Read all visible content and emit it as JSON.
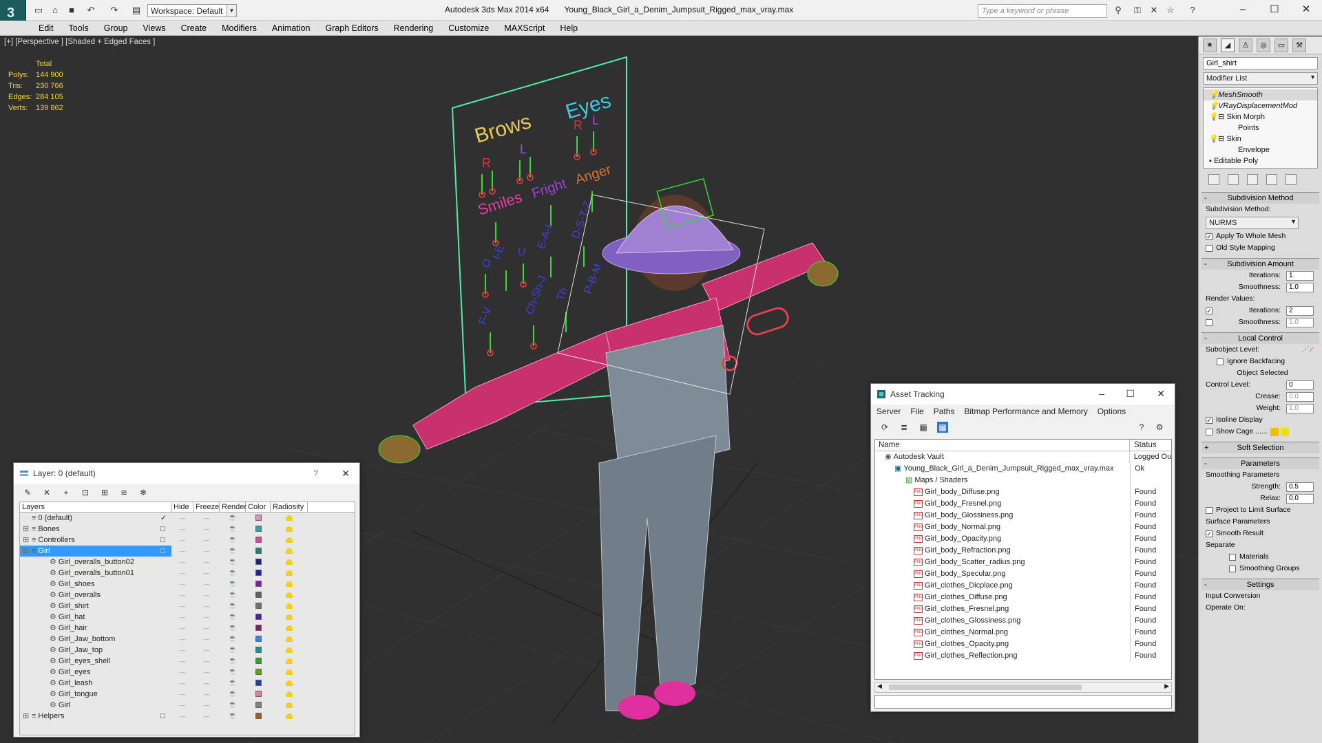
{
  "window": {
    "app_title": "Autodesk 3ds Max  2014 x64",
    "file_title": "Young_Black_Girl_a_Denim_Jumpsuit_Rigged_max_vray.max",
    "workspace": "Workspace: Default",
    "search_placeholder": "Type a keyword or phrase"
  },
  "menu": [
    "Edit",
    "Tools",
    "Group",
    "Views",
    "Create",
    "Modifiers",
    "Animation",
    "Graph Editors",
    "Rendering",
    "Customize",
    "MAXScript",
    "Help"
  ],
  "viewport": {
    "label": "[+] [Perspective ] [Shaded + Edged Faces ]",
    "stats": {
      "total_label": "Total",
      "rows": [
        {
          "k": "Polys:",
          "v": "144 900"
        },
        {
          "k": "Tris:",
          "v": "230 766"
        },
        {
          "k": "Edges:",
          "v": "284 105"
        },
        {
          "k": "Verts:",
          "v": "139 862"
        }
      ]
    },
    "board": {
      "brows": "Brows",
      "eyes": "Eyes",
      "r": "R",
      "l": "L",
      "smiles": "Smiles",
      "fright": "Fright",
      "anger": "Anger",
      "phon1": "O",
      "phon2": "I-E",
      "phon3": "U",
      "phon4": "E-A-I",
      "phon5": "D-S-T-Z",
      "phon6": "F-V",
      "phon7": "Ch-Sh-J",
      "phon8": "Th",
      "phon9": "P-B-M"
    },
    "colors": {
      "pink": "#e0307a",
      "cyan": "#40c8e8",
      "green": "#33dd33",
      "board": "#4ef0a0"
    }
  },
  "command_panel": {
    "object_name": "Girl_shirt",
    "modifier_list": "Modifier List",
    "stack": [
      {
        "label": "MeshSmooth",
        "style": "sel"
      },
      {
        "label": "VRayDisplacementMod",
        "style": "ital"
      },
      {
        "label": "Skin Morph",
        "style": "norm"
      },
      {
        "label": "Points",
        "style": "sub"
      },
      {
        "label": "Skin",
        "style": "norm"
      },
      {
        "label": "Envelope",
        "style": "sub"
      },
      {
        "label": "Editable Poly",
        "style": "norm"
      }
    ],
    "subdivision_method": {
      "title": "Subdivision Method",
      "label": "Subdivision Method:",
      "value": "NURMS",
      "apply_whole": "Apply To Whole Mesh",
      "old_style": "Old Style Mapping"
    },
    "subdivision_amount": {
      "title": "Subdivision Amount",
      "iterations_label": "Iterations:",
      "iterations": "1",
      "smoothness_label": "Smoothness:",
      "smoothness": "1.0",
      "render_values": "Render Values:",
      "r_iterations": "2",
      "r_smoothness": "1.0"
    },
    "local_control": {
      "title": "Local Control",
      "subobject_level": "Subobject Level:",
      "ignore_backfacing": "Ignore Backfacing",
      "object_selected": "Object Selected",
      "control_level_label": "Control Level:",
      "control_level": "0",
      "crease_label": "Crease:",
      "crease": "0.0",
      "weight_label": "Weight:",
      "weight": "1.0",
      "isoline": "Isoline Display",
      "show_cage": "Show Cage ......"
    },
    "soft_selection": "Soft Selection",
    "parameters": {
      "title": "Parameters",
      "smoothing": "Smoothing Parameters",
      "strength_label": "Strength:",
      "strength": "0.5",
      "relax_label": "Relax:",
      "relax": "0.0",
      "project": "Project to Limit Surface",
      "surface": "Surface Parameters",
      "smooth_result": "Smooth Result",
      "separate": "Separate",
      "materials": "Materials",
      "smoothing_groups": "Smoothing Groups"
    },
    "settings": {
      "title": "Settings",
      "input_conversion": "Input Conversion",
      "operate_on": "Operate On:"
    }
  },
  "layer_window": {
    "title": "Layer: 0 (default)",
    "help": "?",
    "columns": [
      "Layers",
      "Hide",
      "Freeze",
      "Render",
      "Color",
      "Radiosity"
    ],
    "rows": [
      {
        "name": "0 (default)",
        "indent": 0,
        "color": "#e090c0",
        "check": "✓",
        "tree": "",
        "sel": false
      },
      {
        "name": "Bones",
        "indent": 0,
        "color": "#30a0a0",
        "check": "□",
        "tree": "⊞",
        "sel": false
      },
      {
        "name": "Controllers",
        "indent": 0,
        "color": "#e040a0",
        "check": "□",
        "tree": "⊞",
        "sel": false
      },
      {
        "name": "Girl",
        "indent": 0,
        "color": "#208080",
        "check": "□",
        "tree": "⊟",
        "sel": true
      },
      {
        "name": "Girl_overalls_button02",
        "indent": 1,
        "color": "#202080",
        "check": "",
        "tree": "",
        "sel": false
      },
      {
        "name": "Girl_overalls_button01",
        "indent": 1,
        "color": "#2020a0",
        "check": "",
        "tree": "",
        "sel": false
      },
      {
        "name": "Girl_shoes",
        "indent": 1,
        "color": "#8020a0",
        "check": "",
        "tree": "",
        "sel": false
      },
      {
        "name": "Girl_overalls",
        "indent": 1,
        "color": "#606060",
        "check": "",
        "tree": "",
        "sel": false
      },
      {
        "name": "Girl_shirt",
        "indent": 1,
        "color": "#707070",
        "check": "",
        "tree": "",
        "sel": false
      },
      {
        "name": "Girl_hat",
        "indent": 1,
        "color": "#5020a0",
        "check": "",
        "tree": "",
        "sel": false
      },
      {
        "name": "Girl_hair",
        "indent": 1,
        "color": "#802060",
        "check": "",
        "tree": "",
        "sel": false
      },
      {
        "name": "Girl_Jaw_bottom",
        "indent": 1,
        "color": "#4080e0",
        "check": "",
        "tree": "",
        "sel": false
      },
      {
        "name": "Girl_Jaw_top",
        "indent": 1,
        "color": "#209090",
        "check": "",
        "tree": "",
        "sel": false
      },
      {
        "name": "Girl_eyes_shell",
        "indent": 1,
        "color": "#30a030",
        "check": "",
        "tree": "",
        "sel": false
      },
      {
        "name": "Girl_eyes",
        "indent": 1,
        "color": "#60a020",
        "check": "",
        "tree": "",
        "sel": false
      },
      {
        "name": "Girl_leash",
        "indent": 1,
        "color": "#2040a0",
        "check": "",
        "tree": "",
        "sel": false
      },
      {
        "name": "Girl_tongue",
        "indent": 1,
        "color": "#e08090",
        "check": "",
        "tree": "",
        "sel": false
      },
      {
        "name": "Girl",
        "indent": 1,
        "color": "#808080",
        "check": "",
        "tree": "",
        "sel": false
      },
      {
        "name": "Helpers",
        "indent": 0,
        "color": "#a06020",
        "check": "□",
        "tree": "⊞",
        "sel": false
      }
    ]
  },
  "asset_window": {
    "title": "Asset Tracking",
    "menu": [
      "Server",
      "File",
      "Paths",
      "Bitmap Performance and Memory",
      "Options"
    ],
    "col_name": "Name",
    "col_status": "Status",
    "rows": [
      {
        "name": "Autodesk Vault",
        "status": "Logged Ou",
        "lvl": 0,
        "icon": "vault"
      },
      {
        "name": "Young_Black_Girl_a_Denim_Jumpsuit_Rigged_max_vray.max",
        "status": "Ok",
        "lvl": 1,
        "icon": "max"
      },
      {
        "name": "Maps / Shaders",
        "status": "",
        "lvl": 2,
        "icon": "maps"
      },
      {
        "name": "Girl_body_Diffuse.png",
        "status": "Found",
        "lvl": 3,
        "icon": "png"
      },
      {
        "name": "Girl_body_Fresnel.png",
        "status": "Found",
        "lvl": 3,
        "icon": "png"
      },
      {
        "name": "Girl_body_Glossiness.png",
        "status": "Found",
        "lvl": 3,
        "icon": "png"
      },
      {
        "name": "Girl_body_Normal.png",
        "status": "Found",
        "lvl": 3,
        "icon": "png"
      },
      {
        "name": "Girl_body_Opacity.png",
        "status": "Found",
        "lvl": 3,
        "icon": "png"
      },
      {
        "name": "Girl_body_Refraction.png",
        "status": "Found",
        "lvl": 3,
        "icon": "png"
      },
      {
        "name": "Girl_body_Scatter_radius.png",
        "status": "Found",
        "lvl": 3,
        "icon": "png"
      },
      {
        "name": "Girl_body_Specular.png",
        "status": "Found",
        "lvl": 3,
        "icon": "png"
      },
      {
        "name": "Girl_clothes_Dicplace.png",
        "status": "Found",
        "lvl": 3,
        "icon": "png"
      },
      {
        "name": "Girl_clothes_Diffuse.png",
        "status": "Found",
        "lvl": 3,
        "icon": "png"
      },
      {
        "name": "Girl_clothes_Fresnel.png",
        "status": "Found",
        "lvl": 3,
        "icon": "png"
      },
      {
        "name": "Girl_clothes_Glossiness.png",
        "status": "Found",
        "lvl": 3,
        "icon": "png"
      },
      {
        "name": "Girl_clothes_Normal.png",
        "status": "Found",
        "lvl": 3,
        "icon": "png"
      },
      {
        "name": "Girl_clothes_Opacity.png",
        "status": "Found",
        "lvl": 3,
        "icon": "png"
      },
      {
        "name": "Girl_clothes_Reflection.png",
        "status": "Found",
        "lvl": 3,
        "icon": "png"
      }
    ]
  }
}
